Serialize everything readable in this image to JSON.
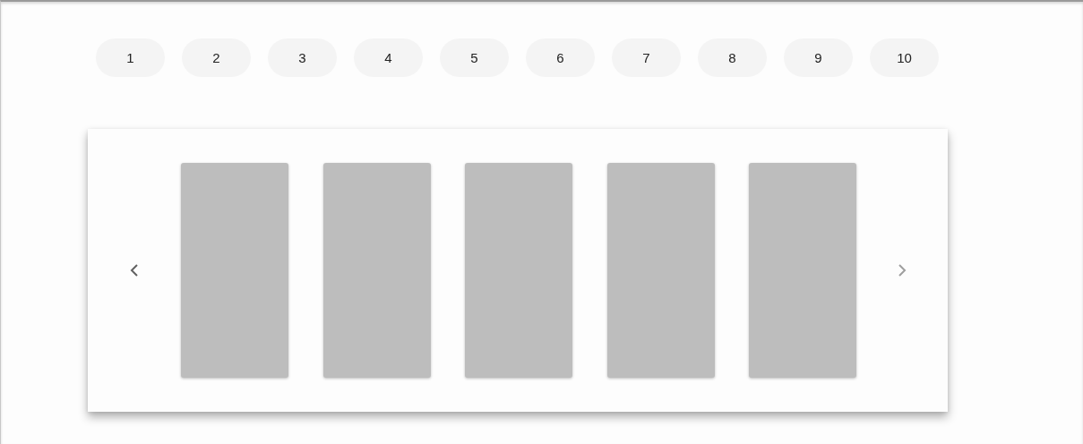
{
  "chips": [
    {
      "label": "1"
    },
    {
      "label": "2"
    },
    {
      "label": "3"
    },
    {
      "label": "4"
    },
    {
      "label": "5"
    },
    {
      "label": "6"
    },
    {
      "label": "7"
    },
    {
      "label": "8"
    },
    {
      "label": "9"
    },
    {
      "label": "10"
    }
  ],
  "carousel": {
    "prev": {
      "disabled": false
    },
    "next": {
      "disabled": true
    },
    "slides": [
      {
        "kind": "blank"
      },
      {
        "kind": "blank"
      },
      {
        "kind": "blank"
      },
      {
        "kind": "blank"
      },
      {
        "kind": "blank"
      }
    ]
  }
}
